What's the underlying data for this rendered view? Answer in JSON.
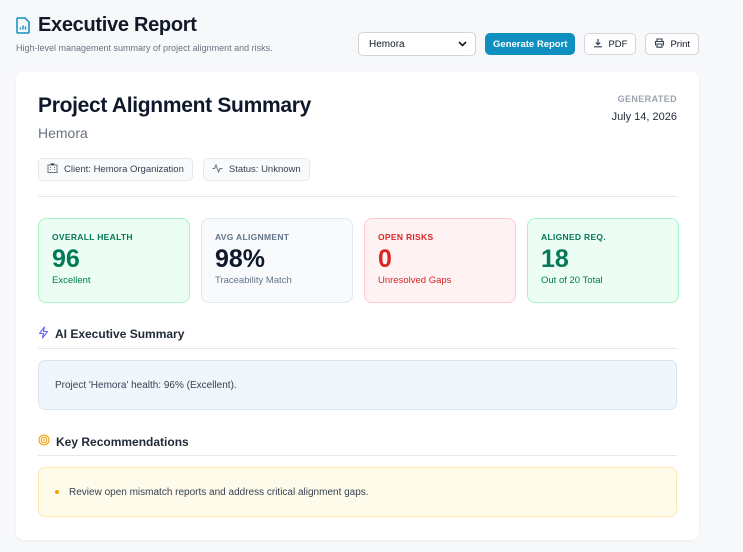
{
  "header": {
    "title": "Executive Report",
    "subtitle": "High-level management summary of project alignment and risks."
  },
  "toolbar": {
    "project_select": {
      "selected": "Hemora"
    },
    "generate_label": "Generate Report",
    "pdf_label": "PDF",
    "print_label": "Print"
  },
  "report": {
    "title": "Project Alignment Summary",
    "project_name": "Hemora",
    "generated_label": "GENERATED",
    "generated_date": "July 14, 2026",
    "client_chip": "Client: Hemora Organization",
    "status_chip": "Status: Unknown"
  },
  "metrics": [
    {
      "label": "OVERALL HEALTH",
      "value": "96",
      "sub": "Excellent"
    },
    {
      "label": "AVG ALIGNMENT",
      "value": "98%",
      "sub": "Traceability Match"
    },
    {
      "label": "OPEN RISKS",
      "value": "0",
      "sub": "Unresolved Gaps"
    },
    {
      "label": "ALIGNED REQ.",
      "value": "18",
      "sub": "Out of 20 Total"
    }
  ],
  "ai_summary": {
    "heading": "AI Executive Summary",
    "text": "Project 'Hemora' health: 96% (Excellent)."
  },
  "recommendations": {
    "heading": "Key Recommendations",
    "items": [
      "Review open mismatch reports and address critical alignment gaps."
    ]
  },
  "colors": {
    "accent": "#0e8fbf",
    "success": "#047857",
    "danger": "#dc2626",
    "warning": "#f59e0b"
  },
  "icons": {
    "title": "file-chart-icon",
    "pdf": "download-icon",
    "print": "printer-icon",
    "client": "building-icon",
    "status": "activity-icon",
    "ai": "zap-icon",
    "recommendations": "target-icon"
  }
}
